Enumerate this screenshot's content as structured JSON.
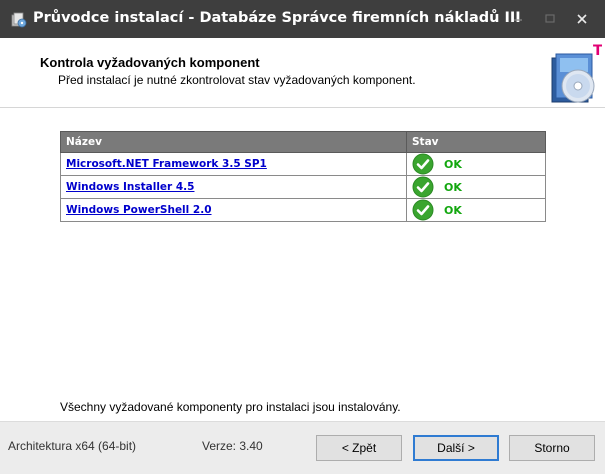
{
  "window": {
    "title": "Průvodce instalací - Databáze Správce firemních nákladů III",
    "controls": {
      "minimize": "–",
      "maximize": "□",
      "close": "✕"
    }
  },
  "header": {
    "title": "Kontrola vyžadovaných komponent",
    "subtitle": "Před instalací je nutné zkontrolovat stav vyžadovaných komponent.",
    "logo_icon": "installer-cd-box-icon"
  },
  "table": {
    "columns": [
      "Název",
      "Stav"
    ],
    "rows": [
      {
        "name": "Microsoft.NET Framework 3.5 SP1",
        "status": "OK"
      },
      {
        "name": "Windows Installer 4.5",
        "status": "OK"
      },
      {
        "name": "Windows PowerShell 2.0",
        "status": "OK"
      }
    ],
    "status_icon": "check-circle-icon",
    "colors": {
      "header_bg": "#7a7a7a",
      "link": "#0000cc",
      "ok": "#13a70f"
    }
  },
  "summary": "Všechny vyžadované komponenty pro instalaci jsou instalovány.",
  "footer": {
    "architecture": "Architektura x64 (64-bit)",
    "version": "Verze: 3.40",
    "back_label": "< Zpět",
    "next_label": "Další >",
    "cancel_label": "Storno"
  },
  "colors": {
    "titlebar": "#3e3e3e",
    "footer_bg": "#ececec",
    "focus_border": "#2f7bd2"
  }
}
